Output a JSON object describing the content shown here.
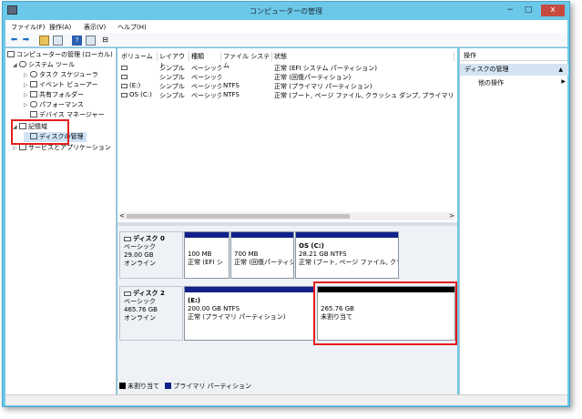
{
  "window": {
    "title": "コンピューターの管理",
    "minimize": "−",
    "maximize": "□",
    "close": "x"
  },
  "menu": {
    "file": "ファイル(F)",
    "action": "操作(A)",
    "view": "表示(V)",
    "help": "ヘルプ(H)"
  },
  "tree": {
    "root": "コンピューターの管理 (ローカル)",
    "system_tools": "システム ツール",
    "task_scheduler": "タスク スケジューラ",
    "event_viewer": "イベント ビューアー",
    "shared_folders": "共有フォルダー",
    "performance": "パフォーマンス",
    "device_manager": "デバイス マネージャー",
    "storage": "記憶域",
    "disk_management": "ディスクの管理",
    "services": "サービスとアプリケーション"
  },
  "volume_table": {
    "headers": [
      "ボリューム",
      "レイアウト",
      "種類",
      "ファイル システム",
      "状態"
    ],
    "rows": [
      {
        "volume": "",
        "layout": "シンプル",
        "type": "ベーシック",
        "fs": "",
        "status": "正常 (EFI システム パーティション)"
      },
      {
        "volume": "",
        "layout": "シンプル",
        "type": "ベーシック",
        "fs": "",
        "status": "正常 (回復パーティション)"
      },
      {
        "volume": "(E:)",
        "layout": "シンプル",
        "type": "ベーシック",
        "fs": "NTFS",
        "status": "正常 (プライマリ パーティション)"
      },
      {
        "volume": "OS (C:)",
        "layout": "シンプル",
        "type": "ベーシック",
        "fs": "NTFS",
        "status": "正常 (ブート, ページ ファイル, クラッシュ ダンプ, プライマリ パーティション)"
      }
    ],
    "scroll_left": "<",
    "scroll_right": ">"
  },
  "disks": [
    {
      "name": "ディスク 0",
      "type": "ベーシック",
      "size": "29.00 GB",
      "status": "オンライン",
      "partitions": [
        {
          "title": "",
          "size": "100 MB",
          "status": "正常 (EFI シ"
        },
        {
          "title": "",
          "size": "700 MB",
          "status": "正常 (回復パーティシ"
        },
        {
          "title": "OS (C:)",
          "size": "28.21 GB NTFS",
          "status": "正常 (ブート, ページ ファイル, クラ"
        }
      ]
    },
    {
      "name": "ディスク 2",
      "type": "ベーシック",
      "size": "465.76 GB",
      "status": "オンライン",
      "partitions": [
        {
          "title": "(E:)",
          "size": "200.00 GB NTFS",
          "status": "正常 (プライマリ パーティション)"
        },
        {
          "title": "",
          "size": "265.76 GB",
          "status": "未割り当て"
        }
      ]
    }
  ],
  "legend": {
    "unallocated": "未割り当て",
    "primary": "プライマリ パーティション"
  },
  "actions": {
    "header": "操作",
    "section": "ディスクの管理",
    "more": "他の操作"
  },
  "colors": {
    "primary_partition": "#10218a",
    "unallocated": "#000000",
    "highlight": "#e41e1e",
    "window_frame": "#6cc8e8"
  }
}
